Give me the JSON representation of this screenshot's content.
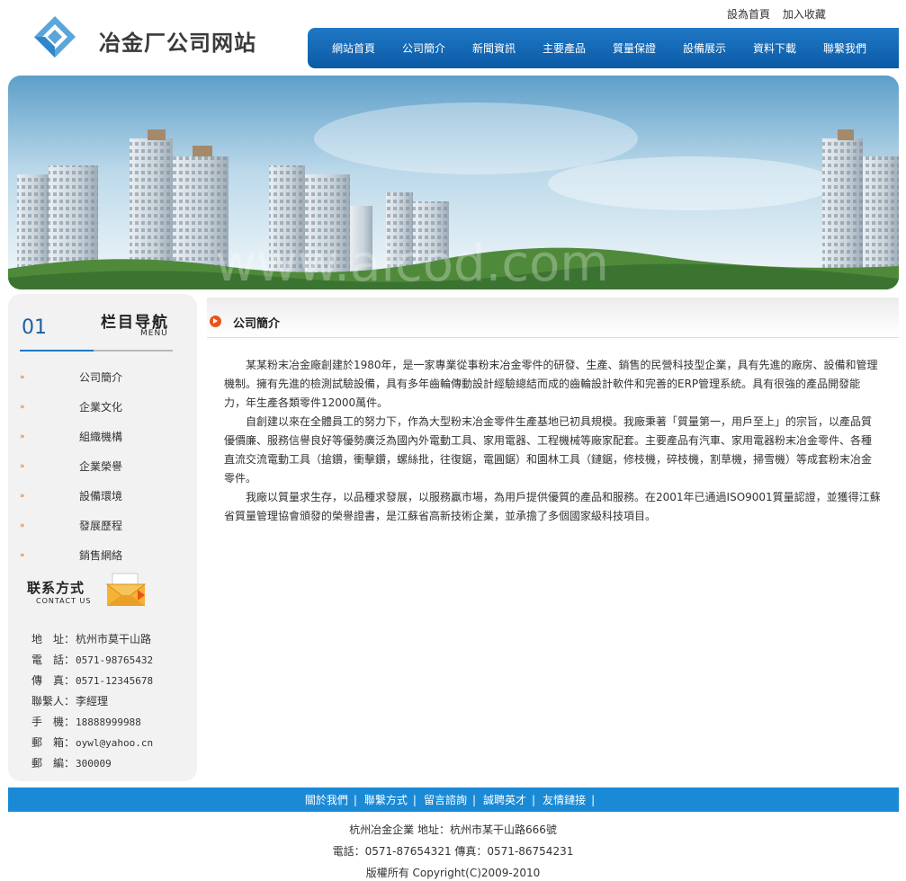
{
  "header": {
    "site_title": "冶金厂公司网站",
    "top_links": [
      "設為首頁",
      "加入收藏"
    ],
    "nav": [
      "網站首頁",
      "公司簡介",
      "新聞資訊",
      "主要產品",
      "質量保證",
      "設備展示",
      "資料下載",
      "聯繫我們"
    ]
  },
  "banner": {
    "watermark": "www.aicod.com"
  },
  "sidebar": {
    "number": "01",
    "title": "栏目导航",
    "subtitle": "MENU",
    "menu": [
      "公司簡介",
      "企業文化",
      "組織機構",
      "企業榮譽",
      "設備環境",
      "發展歷程",
      "銷售網絡"
    ],
    "contact_title": "联系方式",
    "contact_subtitle": "CONTACT US",
    "contact": [
      {
        "k": "地　址：",
        "v": "杭州市莫干山路"
      },
      {
        "k": "電　話：",
        "v": "0571-98765432"
      },
      {
        "k": "傳　真：",
        "v": "0571-12345678"
      },
      {
        "k": "聯繫人：",
        "v": "李經理"
      },
      {
        "k": "手　機：",
        "v": "18888999988"
      },
      {
        "k": "郵　箱：",
        "v": "oywl@yahoo.cn"
      },
      {
        "k": "郵　編：",
        "v": "300009"
      }
    ]
  },
  "content": {
    "title": "公司簡介",
    "paragraphs": [
      "某某粉末冶金廠創建於1980年，是一家專業從事粉末冶金零件的研發、生產、銷售的民營科技型企業，具有先進的廠房、設備和管理機制。擁有先進的檢測試驗設備，具有多年齒輪傳動設計經驗總結而成的齒輪設計軟件和完善的ERP管理系統。具有很強的產品開發能力，年生產各類零件12000萬件。",
      "自創建以來在全體員工的努力下，作為大型粉末冶金零件生產基地已初具規模。我廠秉著「質量第一，用戶至上」的宗旨，以產品質優價廉、服務信譽良好等優勢廣泛為國內外電動工具、家用電器、工程機械等廠家配套。主要產品有汽車、家用電器粉末冶金零件、各種直流交流電動工具（搶鑽，衝擊鑽，螺絲批，往復鋸，電圓鋸）和園林工具（鏈鋸，修枝機，碎枝機，割草機，掃雪機）等成套粉末冶金零件。",
      "我廠以質量求生存，以品種求發展，以服務贏市場，為用戶提供優質的產品和服務。在2001年已通過ISO9001質量認證，並獲得江蘇省質量管理協會頒發的榮譽證書，是江蘇省高新技術企業，並承擔了多個國家級科技項目。"
    ]
  },
  "footer": {
    "links": [
      "關於我們",
      "聯繫方式",
      "留言諮詢",
      "誠聘英才",
      "友情鏈接"
    ],
    "separator": "|",
    "line1": "杭州冶金企業 地址：杭州市某干山路666號",
    "line2": "電話：0571-87654321  傳真：0571-86754231",
    "line3": "版權所有 Copyright(C)2009-2010"
  },
  "colors": {
    "nav_blue": "#0b5aa6",
    "footer_blue": "#1a8ad6",
    "accent_orange": "#e8561a",
    "sidebar_bg": "#f2f2f2"
  },
  "icons": {
    "logo": "diamond-logo-icon",
    "menu_arrow": "arrow-right-icon",
    "contact": "envelope-icon",
    "content_head": "arrow-circle-icon"
  }
}
